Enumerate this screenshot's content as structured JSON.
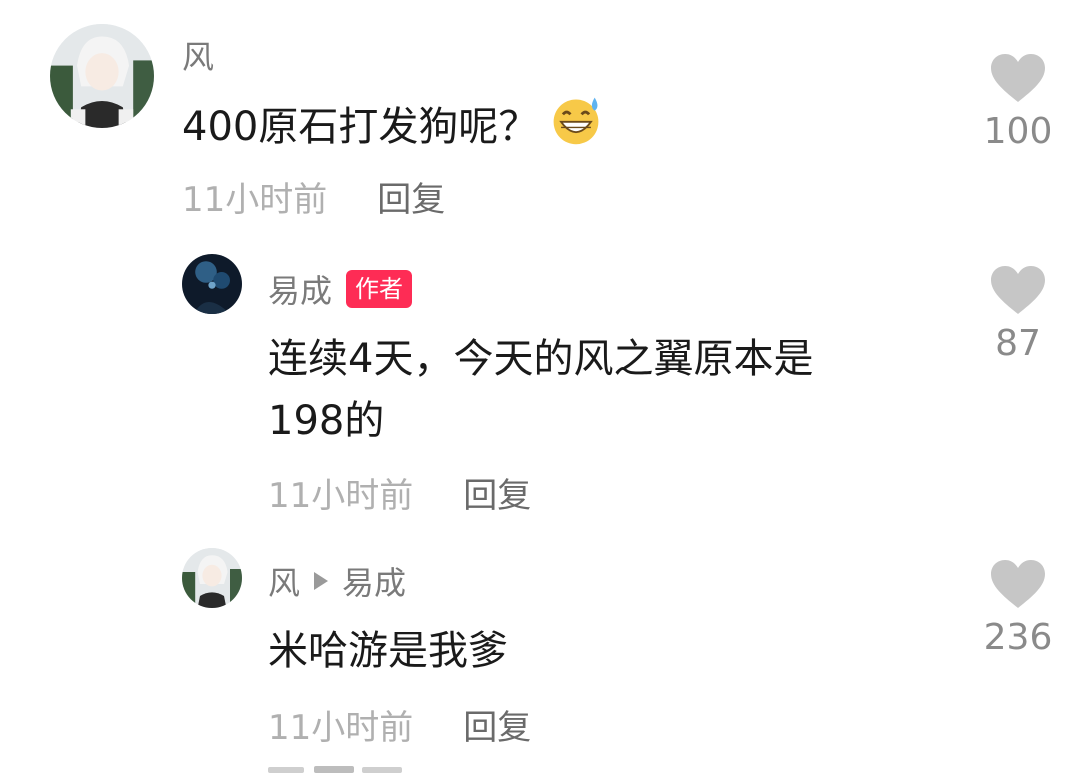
{
  "comments": [
    {
      "username": "风",
      "text": "400原石打发狗呢？",
      "time": "11小时前",
      "reply_label": "回复",
      "likes": "100",
      "emoji": "grinning-sweat-emoji"
    },
    {
      "username": "易成",
      "badge": "作者",
      "text_line1": "连续4天，今天的风之翼原本是",
      "text_line2": "198的",
      "time": "11小时前",
      "reply_label": "回复",
      "likes": "87"
    },
    {
      "username": "风",
      "reply_to": "易成",
      "text": "米哈游是我爹",
      "time": "11小时前",
      "reply_label": "回复",
      "likes": "236"
    }
  ],
  "colors": {
    "badge": "#fe2c55",
    "heart": "#c6c6c6",
    "username": "#7a7a7a",
    "time": "#b0b0b0"
  }
}
